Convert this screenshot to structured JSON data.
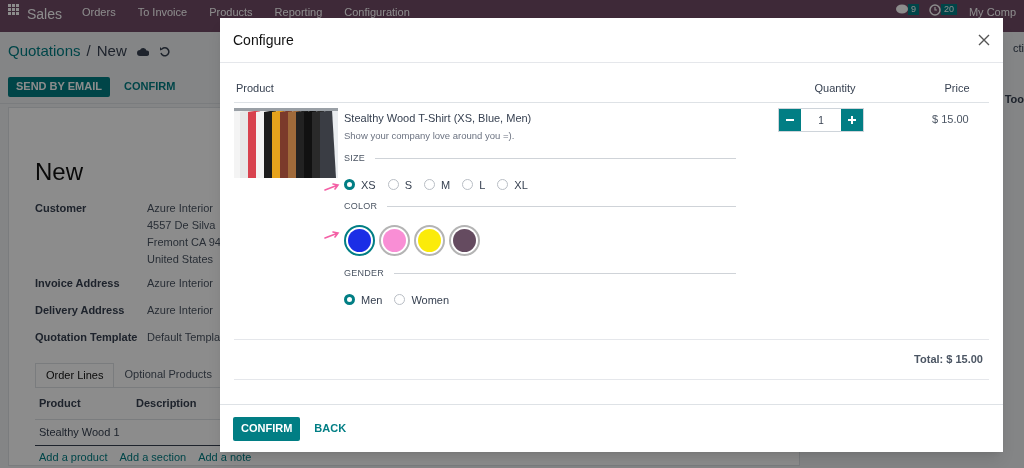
{
  "navbar": {
    "app": "Sales",
    "menu": [
      "Orders",
      "To Invoice",
      "Products",
      "Reporting",
      "Configuration"
    ],
    "messages_badge": "9",
    "activities_badge": "20",
    "company": "My Comp"
  },
  "breadcrumb": {
    "parent": "Quotations",
    "separator": "/",
    "current": "New"
  },
  "actions": [
    {
      "label": "SEND BY EMAIL",
      "kind": "primary"
    },
    {
      "label": "CONFIRM",
      "kind": "secondary"
    }
  ],
  "form": {
    "title": "New",
    "fields": [
      {
        "label": "Customer",
        "lines": [
          "Azure Interior",
          "4557 De Silva",
          "Fremont CA 94",
          "United States"
        ]
      },
      {
        "label": "Invoice Address",
        "lines": [
          "Azure Interior"
        ]
      },
      {
        "label": "Delivery Address",
        "lines": [
          "Azure Interior"
        ]
      },
      {
        "label": "Quotation Template",
        "lines": [
          "Default Templa"
        ]
      }
    ],
    "tabs": [
      {
        "label": "Order Lines",
        "selected": true
      },
      {
        "label": "Optional Products",
        "selected": false
      }
    ],
    "columns": [
      "Product",
      "Description"
    ],
    "rows": [
      "Stealthy Wood 1"
    ],
    "add_links": [
      "Add a product",
      "Add a section",
      "Add a note"
    ]
  },
  "side_panel": [
    "cti",
    "Too"
  ],
  "dialog": {
    "title": "Configure",
    "columns": [
      "Product",
      "Quantity",
      "Price"
    ],
    "product": {
      "name": "Stealthy Wood T-Shirt (XS, Blue, Men)",
      "description": "Show your company love around you =).",
      "quantity": "1",
      "price": "$ 15.00"
    },
    "attributes": [
      {
        "name": "SIZE",
        "kind": "radio",
        "pointer": true,
        "options": [
          {
            "label": "XS",
            "selected": true
          },
          {
            "label": "S",
            "selected": false
          },
          {
            "label": "M",
            "selected": false
          },
          {
            "label": "L",
            "selected": false
          },
          {
            "label": "XL",
            "selected": false
          }
        ]
      },
      {
        "name": "COLOR",
        "kind": "swatch",
        "pointer": true,
        "options": [
          {
            "color": "#1b2ee6",
            "selected": true
          },
          {
            "color": "#f98ed5",
            "selected": false
          },
          {
            "color": "#fbeb0a",
            "selected": false
          },
          {
            "color": "#654b60",
            "selected": false
          }
        ]
      },
      {
        "name": "GENDER",
        "kind": "radio",
        "options": [
          {
            "label": "Men",
            "selected": true
          },
          {
            "label": "Women",
            "selected": false
          }
        ]
      }
    ],
    "total": "Total: $ 15.00",
    "buttons": [
      {
        "label": "CONFIRM",
        "kind": "primary"
      },
      {
        "label": "BACK",
        "kind": "link"
      }
    ]
  }
}
